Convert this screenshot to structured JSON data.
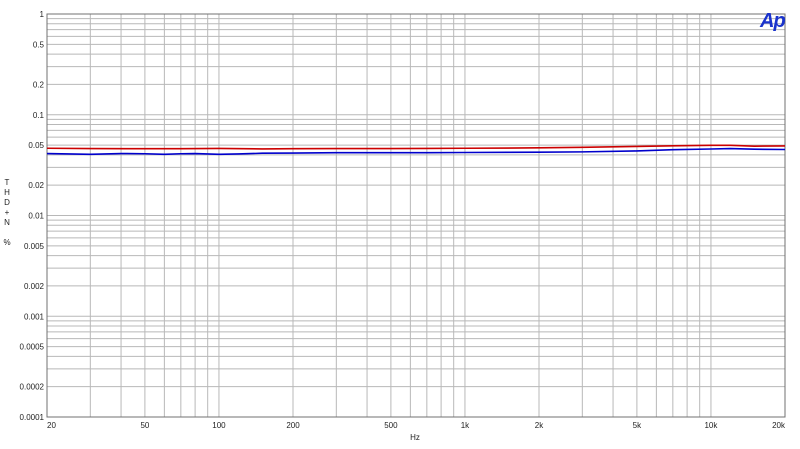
{
  "chart_data": {
    "type": "line",
    "title": "",
    "xlabel": "Hz",
    "ylabel_chars": [
      "T",
      "H",
      "D",
      "+",
      "N",
      "",
      "%"
    ],
    "x_scale": "log",
    "y_scale": "log",
    "xlim": [
      20,
      20000
    ],
    "ylim": [
      0.0001,
      1
    ],
    "grid": true,
    "x_ticks": [
      {
        "value": 20,
        "label": "20"
      },
      {
        "value": 50,
        "label": "50"
      },
      {
        "value": 100,
        "label": "100"
      },
      {
        "value": 200,
        "label": "200"
      },
      {
        "value": 500,
        "label": "500"
      },
      {
        "value": 1000,
        "label": "1k"
      },
      {
        "value": 2000,
        "label": "2k"
      },
      {
        "value": 5000,
        "label": "5k"
      },
      {
        "value": 10000,
        "label": "10k"
      },
      {
        "value": 20000,
        "label": "20k"
      }
    ],
    "y_ticks": [
      {
        "value": 1,
        "label": "1"
      },
      {
        "value": 0.5,
        "label": "0.5"
      },
      {
        "value": 0.2,
        "label": "0.2"
      },
      {
        "value": 0.1,
        "label": "0.1"
      },
      {
        "value": 0.05,
        "label": "0.05"
      },
      {
        "value": 0.02,
        "label": "0.02"
      },
      {
        "value": 0.01,
        "label": "0.01"
      },
      {
        "value": 0.005,
        "label": "0.005"
      },
      {
        "value": 0.002,
        "label": "0.002"
      },
      {
        "value": 0.001,
        "label": "0.001"
      },
      {
        "value": 0.0005,
        "label": "0.0005"
      },
      {
        "value": 0.0002,
        "label": "0.0002"
      },
      {
        "value": 0.0001,
        "label": "0.0001"
      }
    ],
    "series": [
      {
        "color": "#cc0000",
        "x": [
          20,
          30,
          50,
          70,
          100,
          150,
          200,
          300,
          500,
          700,
          1000,
          1500,
          2000,
          3000,
          5000,
          7000,
          10000,
          12000,
          15000,
          20000
        ],
        "y": [
          0.0465,
          0.0462,
          0.046,
          0.046,
          0.0463,
          0.0458,
          0.046,
          0.0462,
          0.0462,
          0.0463,
          0.0465,
          0.0467,
          0.047,
          0.0475,
          0.0485,
          0.0492,
          0.0497,
          0.0497,
          0.0488,
          0.049
        ]
      },
      {
        "color": "#0000cc",
        "x": [
          20,
          30,
          40,
          50,
          60,
          70,
          80,
          100,
          120,
          150,
          200,
          300,
          500,
          700,
          1000,
          1500,
          2000,
          3000,
          5000,
          7000,
          10000,
          12000,
          15000,
          20000
        ],
        "y": [
          0.0412,
          0.0405,
          0.0412,
          0.041,
          0.0405,
          0.041,
          0.0412,
          0.0405,
          0.0408,
          0.0415,
          0.0417,
          0.042,
          0.042,
          0.042,
          0.0422,
          0.0424,
          0.0425,
          0.0428,
          0.0437,
          0.045,
          0.0457,
          0.0462,
          0.0455,
          0.0452
        ]
      }
    ]
  },
  "logo": {
    "text": "Ap",
    "color": "#1a33cc"
  }
}
